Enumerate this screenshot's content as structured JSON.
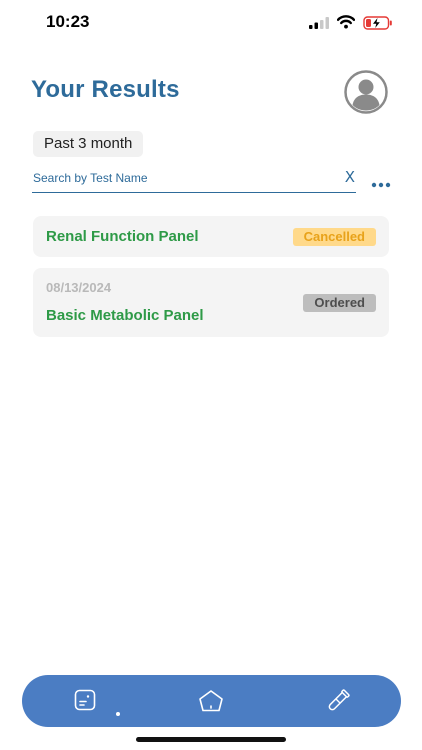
{
  "status_bar": {
    "time": "10:23"
  },
  "header": {
    "title": "Your Results"
  },
  "filter": {
    "period_label": "Past 3 month"
  },
  "search": {
    "placeholder": "Search by Test Name",
    "clear_label": "X"
  },
  "results": [
    {
      "title": "Renal Function Panel",
      "date": "",
      "status": "Cancelled"
    },
    {
      "title": "Basic Metabolic Panel",
      "date": "08/13/2024",
      "status": "Ordered"
    }
  ],
  "tab_bar": {
    "tabs": [
      {
        "icon": "results-icon",
        "selected": true
      },
      {
        "icon": "home-icon",
        "selected": false
      },
      {
        "icon": "test-tube-icon",
        "selected": false
      }
    ]
  },
  "colors": {
    "title": "#2e6b9a",
    "result_title": "#2e9a47",
    "cancelled_bg": "#ffd98a",
    "cancelled_text": "#e8a21a",
    "ordered_bg": "#bdbdbd",
    "tab_bar": "#4b7dc3"
  }
}
